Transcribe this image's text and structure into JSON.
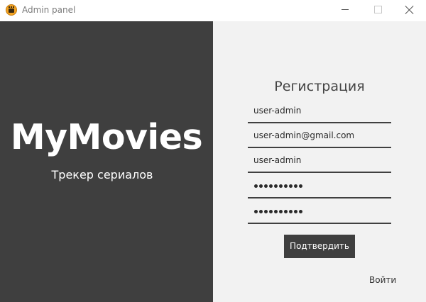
{
  "window": {
    "title": "Admin panel",
    "icon": "film-clapper-icon"
  },
  "brand": {
    "name": "MyMovies",
    "tagline": "Трекер сериалов"
  },
  "form": {
    "title": "Регистрация",
    "fields": [
      {
        "name": "username",
        "value": "user-admin",
        "masked": false
      },
      {
        "name": "email",
        "value": "user-admin@gmail.com",
        "masked": false
      },
      {
        "name": "login",
        "value": "user-admin",
        "masked": false
      },
      {
        "name": "password",
        "masked": true,
        "mask_length": 10
      },
      {
        "name": "password-confirm",
        "masked": true,
        "mask_length": 10
      }
    ],
    "submit_label": "Подтвердить",
    "login_link_label": "Войти"
  },
  "colors": {
    "left_panel": "#3f3f3f",
    "right_panel": "#f2f2f2",
    "button": "#3f3f3f"
  }
}
